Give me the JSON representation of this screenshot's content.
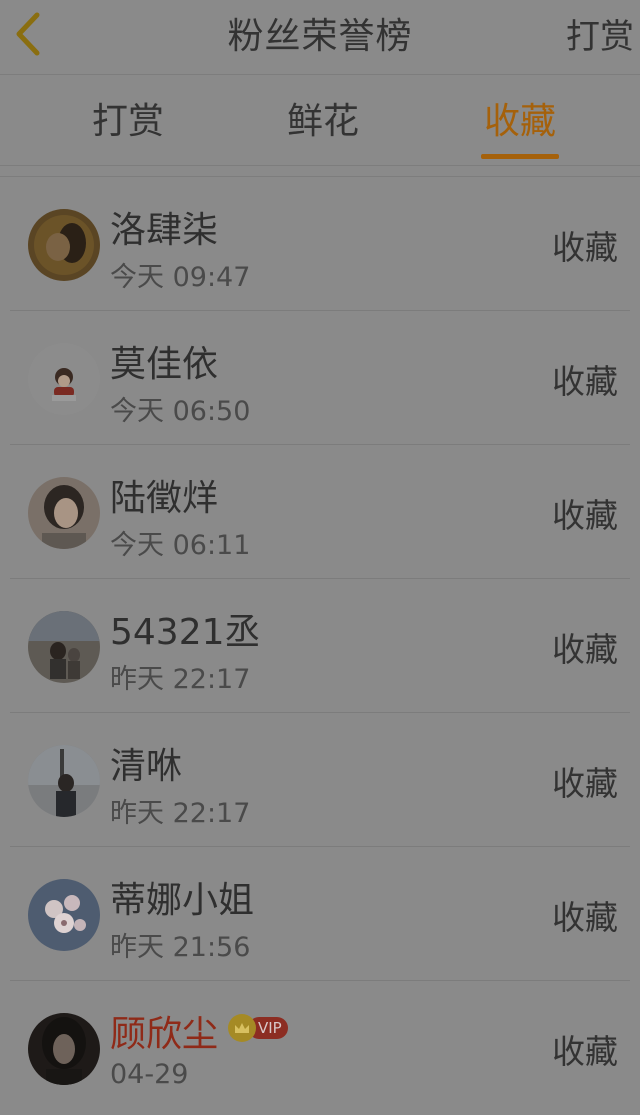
{
  "header": {
    "title": "粉丝荣誉榜",
    "right_label": "打赏"
  },
  "tabs": [
    {
      "label": "打赏",
      "active": false
    },
    {
      "label": "鲜花",
      "active": false
    },
    {
      "label": "收藏",
      "active": true
    }
  ],
  "colors": {
    "accent": "#a5610b",
    "vip_name": "#8f2a18",
    "background": "#8a8a8a"
  },
  "list": [
    {
      "name": "洛肆柒",
      "time": "今天 09:47",
      "action": "收藏",
      "vip": false
    },
    {
      "name": "莫佳依",
      "time": "今天 06:50",
      "action": "收藏",
      "vip": false
    },
    {
      "name": "陆徵烊",
      "time": "今天 06:11",
      "action": "收藏",
      "vip": false
    },
    {
      "name": "54321丞",
      "time": "昨天 22:17",
      "action": "收藏",
      "vip": false
    },
    {
      "name": "清咻",
      "time": "昨天 22:17",
      "action": "收藏",
      "vip": false
    },
    {
      "name": "蒂娜小姐",
      "time": "昨天 21:56",
      "action": "收藏",
      "vip": false
    },
    {
      "name": "顾欣尘",
      "time": "04-29",
      "action": "收藏",
      "vip": true,
      "vip_label": "VIP"
    }
  ]
}
